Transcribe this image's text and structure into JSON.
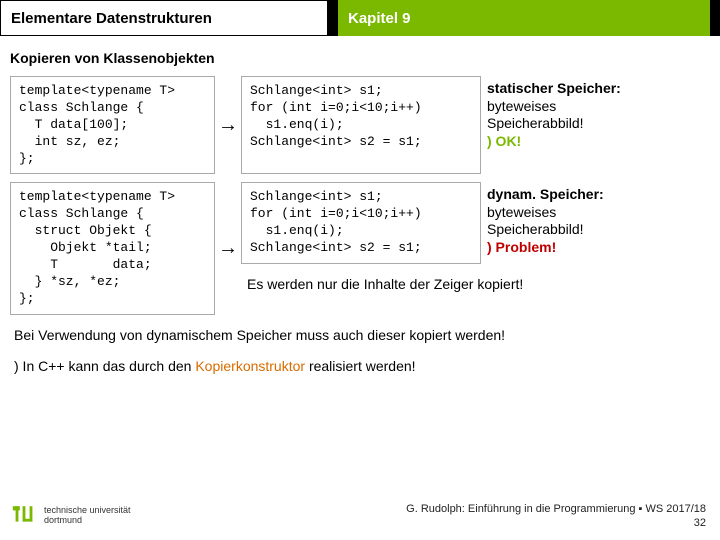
{
  "header": {
    "left": "Elementare Datenstrukturen",
    "right": "Kapitel 9"
  },
  "subtitle": "Kopieren von Klassenobjekten",
  "row1": {
    "codeA": "template<typename T>\nclass Schlange {\n  T data[100];\n  int sz, ez;\n};",
    "arrow": "→",
    "codeB": "Schlange<int> s1;\nfor (int i=0;i<10;i++)\n  s1.enq(i);\nSchlange<int> s2 = s1;",
    "annotTitle": "statischer Speicher:",
    "annotL1": "byteweises",
    "annotL2": "Speicherabbild!",
    "annotResult": ") OK!"
  },
  "row2": {
    "codeA": "template<typename T>\nclass Schlange {\n  struct Objekt {\n    Objekt *tail;\n    T       data;\n  } *sz, *ez;\n};",
    "arrow": "→",
    "codeB": "Schlange<int> s1;\nfor (int i=0;i<10;i++)\n  s1.enq(i);\nSchlange<int> s2 = s1;",
    "annotTitle": "dynam. Speicher:",
    "annotL1": "byteweises",
    "annotL2": "Speicherabbild!",
    "annotResult": ") Problem!",
    "pointerNote": "Es werden nur die Inhalte der Zeiger kopiert!"
  },
  "bottom": {
    "line1": "Bei Verwendung von dynamischem Speicher muss auch dieser kopiert werden!",
    "line2a": ") In C++ kann das durch den ",
    "line2b": "Kopierkonstruktor",
    "line2c": " realisiert werden!"
  },
  "footer": {
    "uni1": "technische universität",
    "uni2": "dortmund",
    "credit": "G. Rudolph: Einführung in die Programmierung ▪ WS 2017/18",
    "page": "32"
  }
}
